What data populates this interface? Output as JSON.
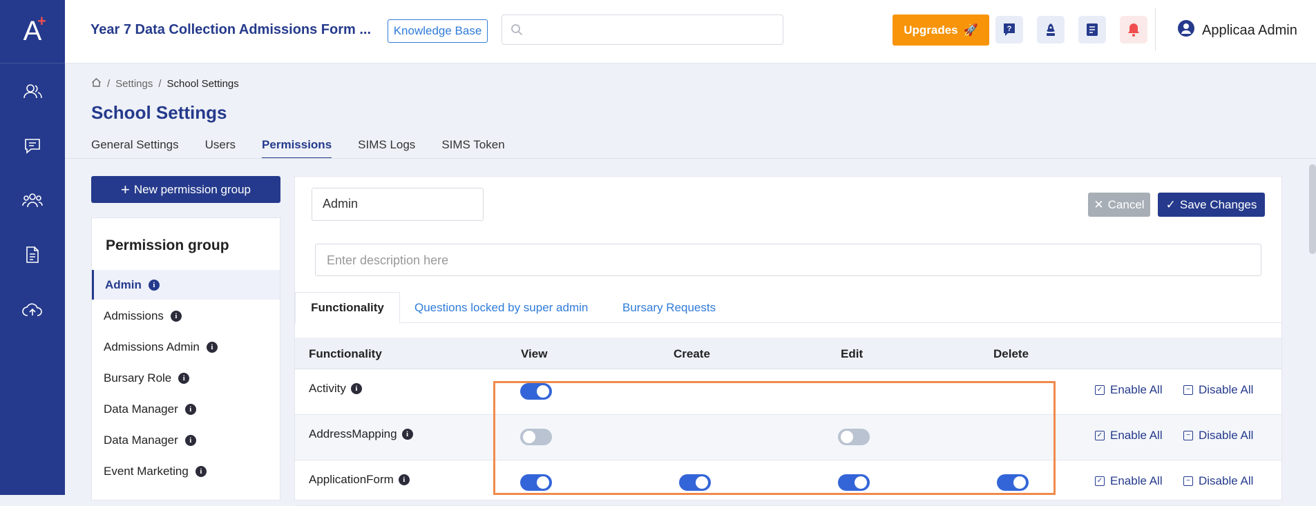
{
  "app": {
    "logo_text": "A",
    "logo_plus": "+"
  },
  "rail": {
    "items": [
      "users-icon",
      "chat-icon",
      "group-icon",
      "document-icon",
      "cloud-upload-icon"
    ]
  },
  "header": {
    "title": "Year 7 Data Collection Admissions Form ...",
    "knowledge_base": "Knowledge Base",
    "search_placeholder": "",
    "upgrades": "Upgrades",
    "upgrades_emoji": "🚀",
    "user_name": "Applicaa Admin",
    "icons": [
      "help-icon",
      "rocket-icon",
      "notes-icon",
      "bell-icon"
    ]
  },
  "breadcrumb": {
    "settings": "Settings",
    "separator": "/",
    "current": "School Settings"
  },
  "page": {
    "title": "School Settings"
  },
  "tabs": [
    "General Settings",
    "Users",
    "Permissions",
    "SIMS Logs",
    "SIMS Token"
  ],
  "sidebar": {
    "new_button": "New permission group",
    "heading": "Permission group",
    "groups": [
      "Admin",
      "Admissions",
      "Admissions Admin",
      "Bursary Role",
      "Data Manager",
      "Data Manager",
      "Event Marketing"
    ]
  },
  "editor": {
    "group_name": "Admin",
    "cancel": "Cancel",
    "save": "Save Changes",
    "description_placeholder": "Enter description here",
    "inner_tabs": [
      "Functionality",
      "Questions locked by super admin",
      "Bursary Requests"
    ]
  },
  "table": {
    "columns": [
      "Functionality",
      "View",
      "Create",
      "Edit",
      "Delete"
    ],
    "enable_all": "Enable All",
    "disable_all": "Disable All",
    "rows": [
      {
        "name": "Activity",
        "view": true,
        "create": null,
        "edit": null,
        "delete": null
      },
      {
        "name": "AddressMapping",
        "view": false,
        "create": null,
        "edit": false,
        "delete": null
      },
      {
        "name": "ApplicationForm",
        "view": true,
        "create": true,
        "edit": true,
        "delete": true
      }
    ]
  },
  "colors": {
    "primary": "#253a8c",
    "accent": "#f7940a",
    "highlight": "#f08a4b",
    "toggle_on": "#3465d8"
  }
}
